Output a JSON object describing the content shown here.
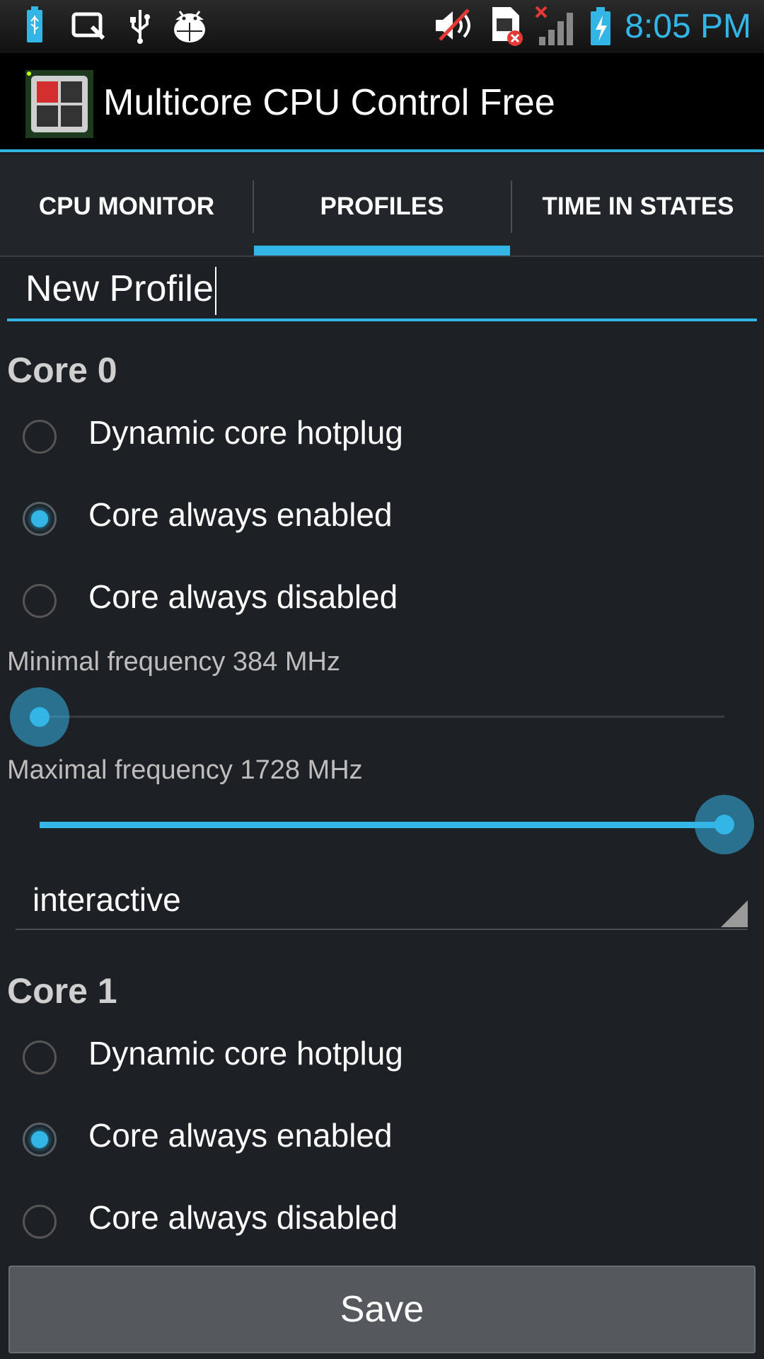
{
  "status_bar": {
    "time": "8:05 PM",
    "icons": [
      "usb-battery-icon",
      "quick-memo-icon",
      "usb-icon",
      "android-debug-icon",
      "mute-icon",
      "no-sim-icon",
      "no-signal-icon",
      "battery-charging-icon"
    ]
  },
  "app": {
    "title": "Multicore CPU Control Free"
  },
  "tabs": [
    {
      "label": "CPU MONITOR",
      "selected": false
    },
    {
      "label": "PROFILES",
      "selected": true
    },
    {
      "label": "TIME IN STATES",
      "selected": false
    }
  ],
  "profile": {
    "name": "New Profile"
  },
  "cores": [
    {
      "title": "Core 0",
      "options": [
        {
          "label": "Dynamic core hotplug",
          "checked": false
        },
        {
          "label": "Core always enabled",
          "checked": true
        },
        {
          "label": "Core always disabled",
          "checked": false
        }
      ],
      "min_freq_label": "Minimal frequency 384 MHz",
      "min_freq_fraction": 0.0,
      "max_freq_label": "Maximal frequency 1728 MHz",
      "max_freq_fraction": 1.0,
      "governor": "interactive"
    },
    {
      "title": "Core 1",
      "options": [
        {
          "label": "Dynamic core hotplug",
          "checked": false
        },
        {
          "label": "Core always enabled",
          "checked": true
        },
        {
          "label": "Core always disabled",
          "checked": false
        }
      ]
    }
  ],
  "save_button": "Save",
  "colors": {
    "accent": "#33b5e5",
    "background": "#1d2024",
    "action_bar": "#000000"
  }
}
